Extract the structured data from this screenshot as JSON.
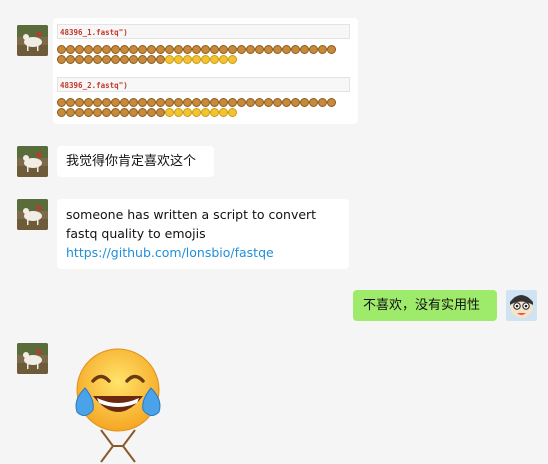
{
  "messages": {
    "code_line_1": "48396_1.fastq\")",
    "code_line_2": "48396_2.fastq\")",
    "msg2": "我觉得你肯定喜欢这个",
    "msg3_text": "someone has written a script to convert fastq quality to emojis ",
    "msg3_link": "https://github.com/lonsbio/fastqe",
    "msg4": "不喜欢，没有实用性"
  },
  "icons": {
    "sender_avatar": "goat-photo-avatar",
    "self_avatar": "cartoon-avatar",
    "sticker": "tears-of-joy-emoji-sticker"
  },
  "colors": {
    "bg": "#f5f5f5",
    "incoming_bubble": "#ffffff",
    "outgoing_bubble": "#9eea6a",
    "link": "#1f8fd8",
    "code_text": "#c0392b"
  }
}
